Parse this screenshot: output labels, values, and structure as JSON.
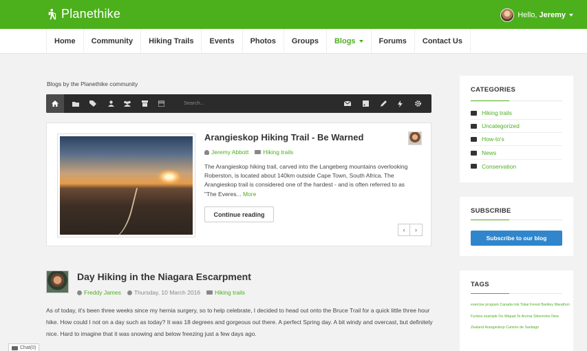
{
  "header": {
    "brand": "Planethike",
    "greeting": "Hello,",
    "username": "Jeremy",
    "colors": {
      "brand_green": "#4caf1c",
      "button_blue": "#2f86cc"
    }
  },
  "nav": {
    "items": [
      "Home",
      "Community",
      "Hiking Trails",
      "Events",
      "Photos",
      "Groups",
      "Blogs",
      "Forums",
      "Contact Us"
    ],
    "active": "Blogs"
  },
  "blog": {
    "intro": "Blogs by the Planethike community",
    "toolbar": {
      "search_placeholder": "Search...",
      "icons": [
        "home-icon",
        "folder-icon",
        "tags-icon",
        "user-icon",
        "group-icon",
        "archive-icon",
        "calendar-icon",
        "mail-icon",
        "rss-icon",
        "pencil-icon",
        "bolt-icon",
        "gear-icon"
      ]
    }
  },
  "featured": {
    "title": "Arangieskop Hiking Trail - Be Warned",
    "author": "Jeremy Abbott",
    "category": "Hiking trails",
    "excerpt": "The Arangieskop hiking trail, carved into the Langeberg mountains overlooking Roberston, is located about 140km outside Cape Town, South Africa. The Arangieskop trail is considered one of the hardest - and is often referred to as \"The Everes...",
    "more_label": "More",
    "continue_label": "Continue reading",
    "prev_label": "‹",
    "next_label": "›"
  },
  "post2": {
    "title": "Day Hiking in the Niagara Escarpment",
    "author": "Freddy James",
    "date": "Thursday, 10 March 2016",
    "category": "Hiking trails",
    "body": "As of today, it's been three weeks since my hernia surgery, so to help celebrate, I decided to head out onto the Bruce Trail for a quick little three hour hike. How could I not on a day such as today? It was 18 degrees and gorgeous out there. A perfect Spring day. A bit windy and overcast, but definitely nice. Hard to imagine that it was snowing and below freezing just a few days ago."
  },
  "chat": {
    "label": "Chat(0)"
  },
  "sidebar": {
    "categories": {
      "title": "CATEGORIES",
      "items": [
        "Hiking trails",
        "Uncategorized",
        "How-to's",
        "News",
        "Conservation"
      ]
    },
    "subscribe": {
      "title": "SUBSCRIBE",
      "button": "Subscribe to our blog"
    },
    "tags": {
      "title": "TAGS",
      "text": "exercise program Canada risk Tokai Forest Barkley Marathon Fynbos example Ou Wapad Te Aroroa Silvermine New Zealand Arangieskop Camino de Santiago"
    }
  }
}
